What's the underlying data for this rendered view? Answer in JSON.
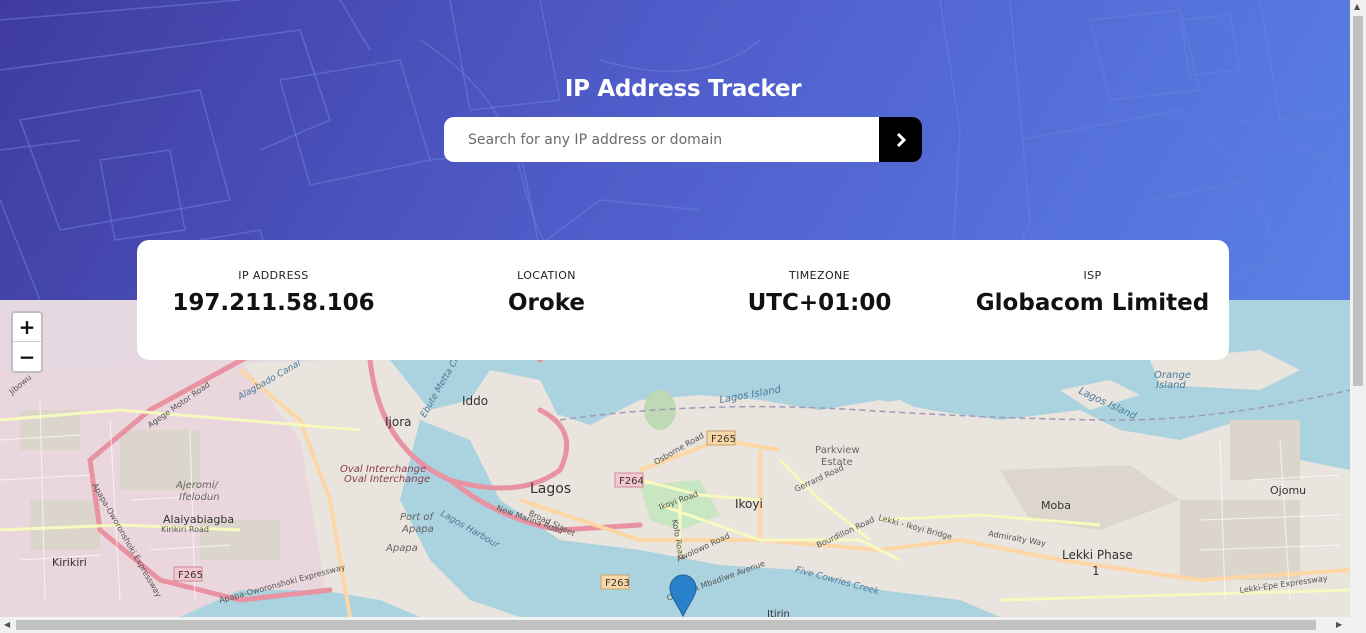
{
  "header": {
    "title": "IP Address Tracker",
    "search_placeholder": "Search for any IP address or domain",
    "search_value": ""
  },
  "info": [
    {
      "label": "IP ADDRESS",
      "value": "197.211.58.106"
    },
    {
      "label": "LOCATION",
      "value": "Oroke"
    },
    {
      "label": "TIMEZONE",
      "value": "UTC+01:00"
    },
    {
      "label": "ISP",
      "value": "Globacom Limited"
    }
  ],
  "map": {
    "zoom_in": "+",
    "zoom_out": "−",
    "labels": [
      "Iddo",
      "Ijora",
      "Oval Interchange",
      "Oval Interchange",
      "Ajeromi/ Ifelodun",
      "Alaiyabiagba",
      "Kirikiri Road",
      "Kirikiri",
      "Port of Apapa",
      "Apapa",
      "Lagos Harbour",
      "Lagos",
      "Broad Street",
      "New Marina Road",
      "F264",
      "F265",
      "F265",
      "F263",
      "Osborne Road",
      "Ikoyi",
      "Ikoyi Road",
      "Kofo Road",
      "Awolowo Road",
      "Gerrard Road",
      "Parkview Estate",
      "Bourdillon Road",
      "Lekki - Ikoyi Bridge",
      "Admiralty Way",
      "Moba",
      "Lekki Phase 1",
      "Ojomu",
      "Lekki-Epe Expressway",
      "Orange Island",
      "Lagos Island",
      "Lagos Island",
      "Five Cowries Creek",
      "Ozumba Mbadiwe Avenue",
      "Itirin",
      "Ebute Metta Creek",
      "Apapa-Oworonshoki Expressway",
      "Apapa-Oworonshoki Expressway",
      "Jibowu",
      "Agege Motor Road",
      "Alagbado Canal"
    ],
    "colors": {
      "water": "#aad3df",
      "land": "#e9e4dd",
      "road_major": "#e892a2",
      "road_secondary": "#f7fabf",
      "road_primary": "#fcd6a4",
      "marker": "#2a81cb"
    }
  },
  "icons": {
    "search_arrow": "chevron-right-icon",
    "marker": "map-marker-icon"
  }
}
